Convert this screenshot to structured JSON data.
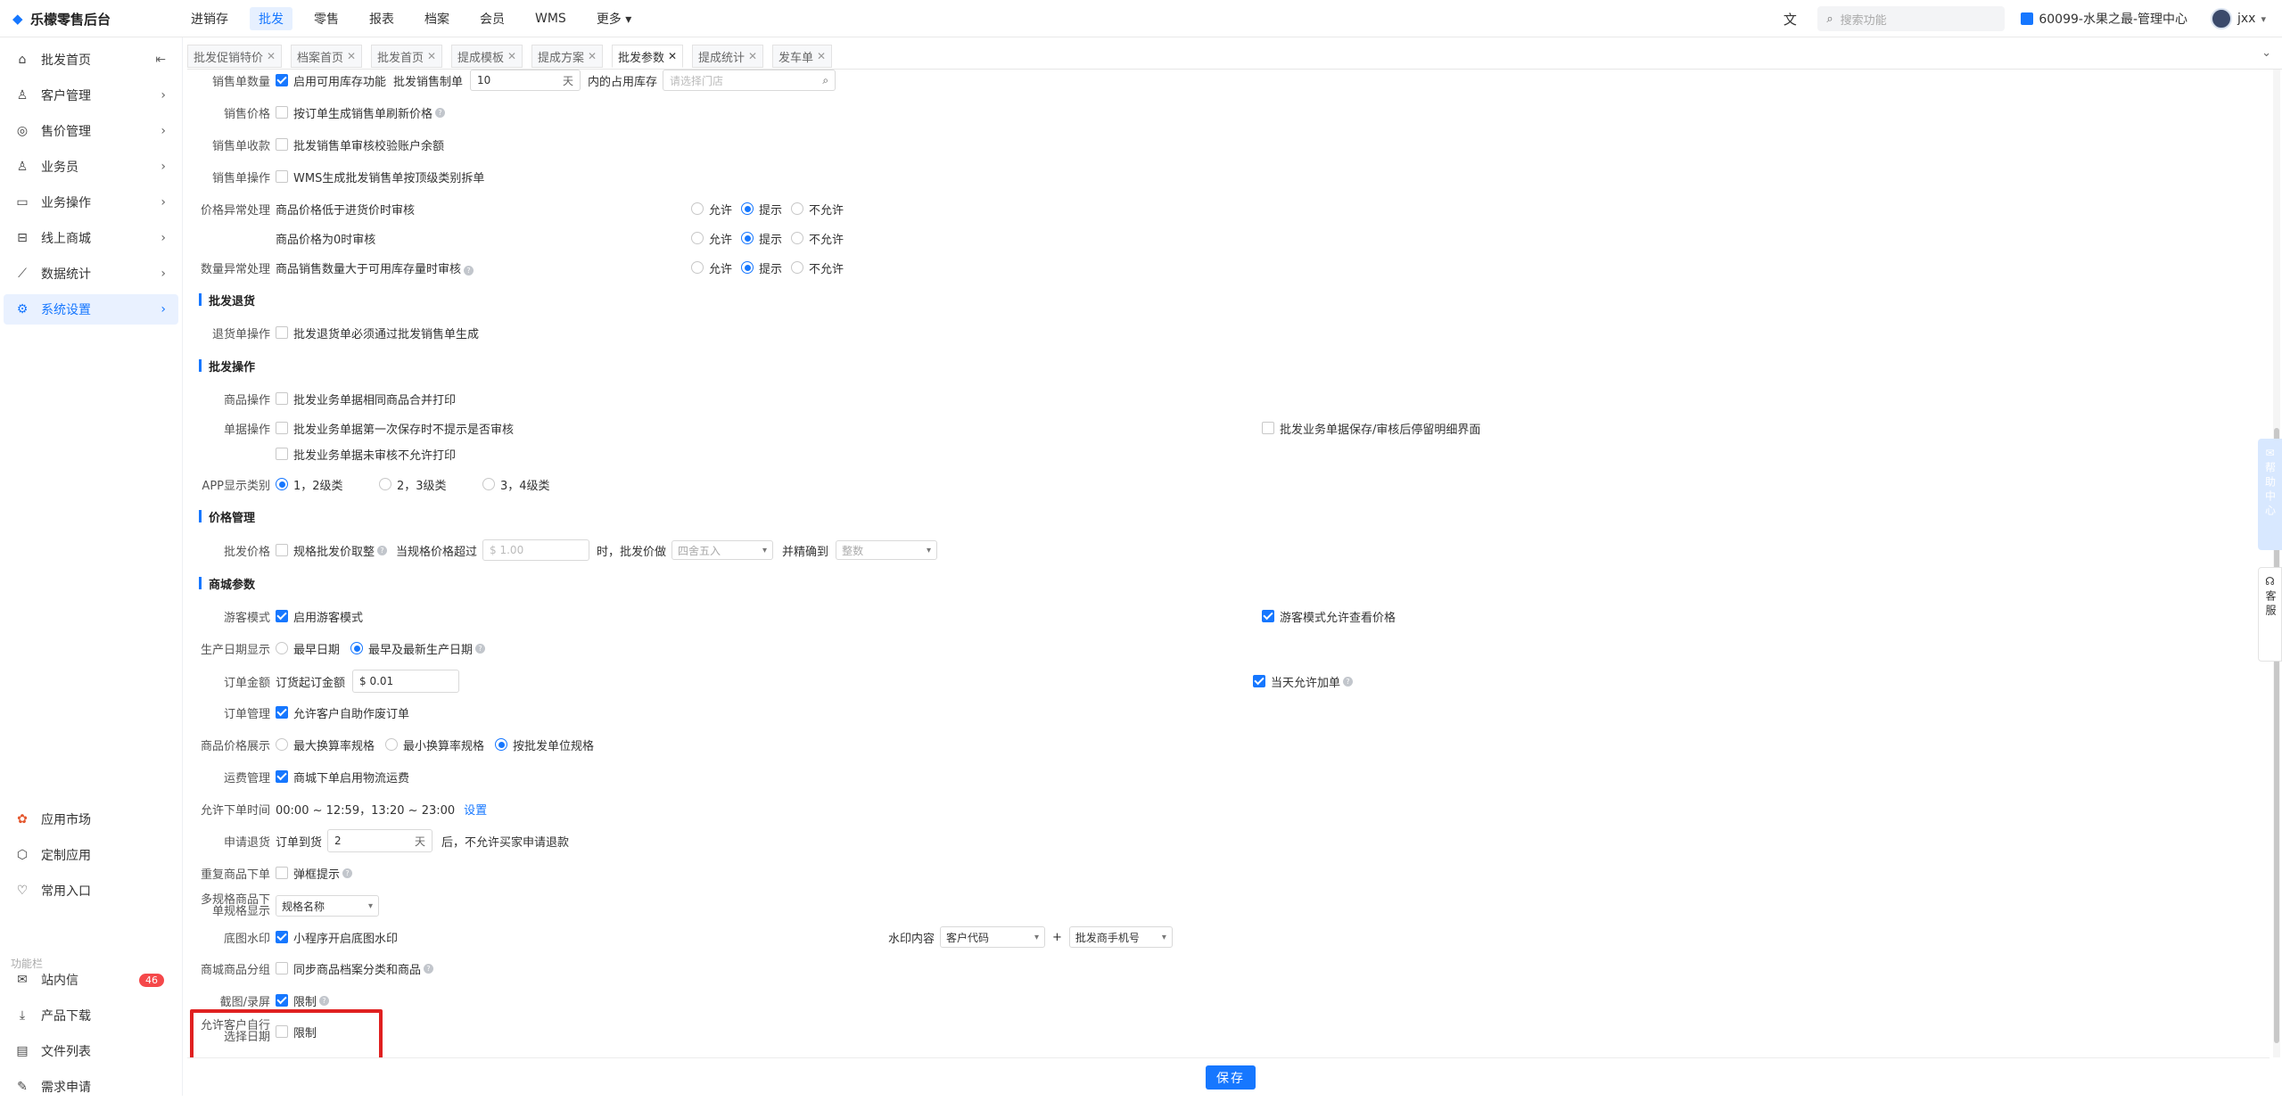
{
  "app_title": "乐檬零售后台",
  "topnav": [
    "进销存",
    "批发",
    "零售",
    "报表",
    "档案",
    "会员",
    "WMS",
    "更多"
  ],
  "search_placeholder": "搜索功能",
  "org": "60099-水果之最-管理中心",
  "user": "jxx",
  "sidebar": {
    "items": [
      "批发首页",
      "客户管理",
      "售价管理",
      "业务员",
      "业务操作",
      "线上商城",
      "数据统计",
      "系统设置"
    ],
    "bottom": [
      "应用市场",
      "定制应用",
      "常用入口"
    ],
    "func_label": "功能栏",
    "func_items": [
      "站内信",
      "产品下载",
      "文件列表",
      "需求申请"
    ],
    "msg_badge": "46"
  },
  "tabs": [
    "批发促销特价",
    "档案首页",
    "批发首页",
    "提成模板",
    "提成方案",
    "批发参数",
    "提成统计",
    "发车单"
  ],
  "settings": {
    "sale_qty_label": "销售单数量",
    "enable_stock": "启用可用库存功能",
    "pre_days_label": "批发销售制单",
    "days_value": "10",
    "days_unit": "天",
    "occupy_label": "内的占用库存",
    "store_placeholder": "请选择门店",
    "sale_price_label": "销售价格",
    "refresh_price": "按订单生成销售单刷新价格",
    "receipt_label": "销售单收款",
    "check_balance": "批发销售单审核校验账户余额",
    "op_label": "销售单操作",
    "wms_split": "WMS生成批发销售单按顶级类别拆单",
    "price_abn_label": "价格异常处理",
    "price_low": "商品价格低于进货价时审核",
    "price_zero": "商品价格为0时审核",
    "qty_abn_label": "数量异常处理",
    "qty_over": "商品销售数量大于可用库存量时审核",
    "allow": "允许",
    "tip": "提示",
    "deny": "不允许",
    "return_section": "批发退货",
    "return_op_label": "退货单操作",
    "return_must": "批发退货单必须通过批发销售单生成",
    "op_section": "批发操作",
    "goods_op_label": "商品操作",
    "merge_print": "批发业务单据相同商品合并打印",
    "doc_op_label": "单据操作",
    "no_audit_prompt": "批发业务单据第一次保存时不提示是否审核",
    "no_print_unaudited": "批发业务单据未审核不允许打印",
    "stay_detail": "批发业务单据保存/审核后停留明细界面",
    "app_cat_label": "APP显示类别",
    "cat12": "1，2级类",
    "cat23": "2，3级类",
    "cat34": "3，4级类",
    "price_section": "价格管理",
    "wholesale_price_label": "批发价格",
    "spec_round": "规格批发价取整",
    "over_label": "当规格价格超过",
    "over_value": "$ 1.00",
    "then_label": "时，批发价做",
    "round_value": "四舍五入",
    "precise_label": "并精确到",
    "precise_value": "整数",
    "mall_section": "商城参数",
    "guest_label": "游客模式",
    "enable_guest": "启用游客模式",
    "guest_price": "游客模式允许查看价格",
    "date_label": "生产日期显示",
    "earliest": "最早日期",
    "earliest_newest": "最早及最新生产日期",
    "amount_label": "订单金额",
    "min_amount_label": "订货起订金额",
    "min_amount_value": "$ 0.01",
    "add_today": "当天允许加单",
    "order_mgmt_label": "订单管理",
    "cancel_self": "允许客户自助作废订单",
    "price_disp_label": "商品价格展示",
    "max_rate": "最大换算率规格",
    "min_rate": "最小换算率规格",
    "by_unit": "按批发单位规格",
    "freight_label": "运费管理",
    "logistics_fee": "商城下单启用物流运费",
    "time_label": "允许下单时间",
    "time_value": "00:00 ~ 12:59，13:20 ~ 23:00",
    "set_link": "设置",
    "refund_label": "申请退货",
    "refund_prefix": "订单到货",
    "refund_days": "2",
    "refund_unit": "天",
    "refund_suffix": "后，不允许买家申请退款",
    "dup_label": "重复商品下单",
    "popup_tip": "弹框提示",
    "multi_label_1": "多规格商品下",
    "multi_label_2": "单规格显示",
    "multi_value": "规格名称",
    "watermark_label": "底图水印",
    "wm_enable": "小程序开启底图水印",
    "wm_content_label": "水印内容",
    "wm_value1": "客户代码",
    "wm_value2": "批发商手机号",
    "plus": "+",
    "group_label": "商城商品分组",
    "sync_group": "同步商品档案分类和商品",
    "screen_label": "截图/录屏",
    "limit": "限制",
    "self_date_label_1": "允许客户自行",
    "self_date_label_2": "选择日期",
    "save": "保存"
  },
  "float_help": "帮助中心",
  "float_kefu": "客服"
}
